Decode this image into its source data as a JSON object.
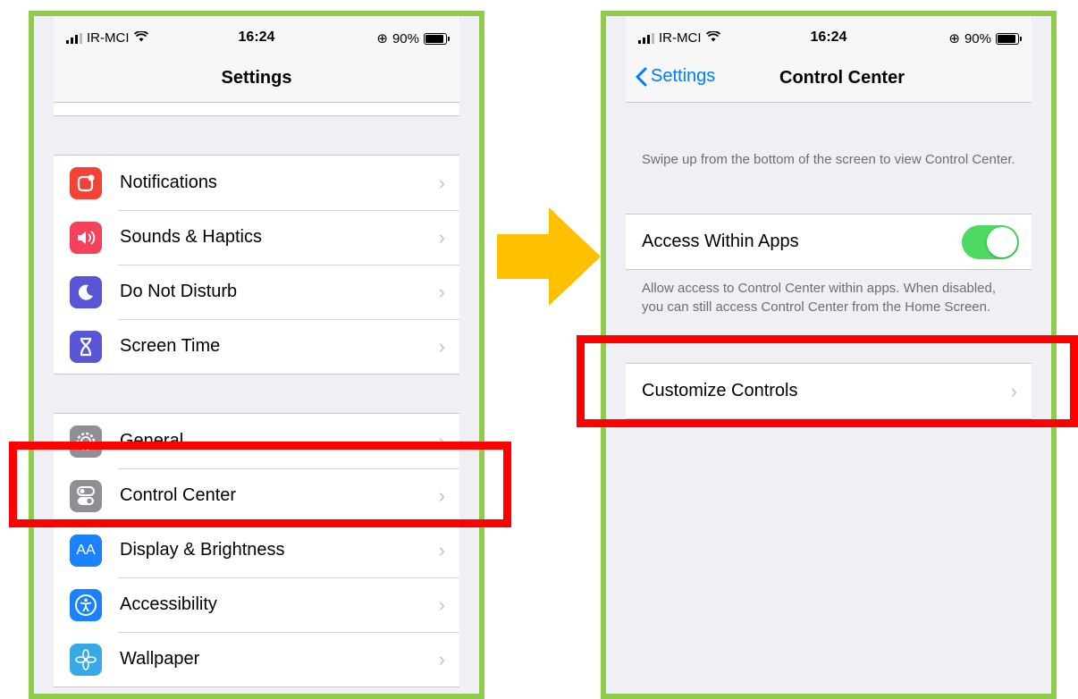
{
  "statusbar": {
    "carrier": "IR-MCI",
    "time": "16:24",
    "battery": "90%"
  },
  "left_screen": {
    "title": "Settings",
    "group1": [
      {
        "label": "Notifications",
        "icon": "notifications-icon",
        "color": "#f44336"
      },
      {
        "label": "Sounds & Haptics",
        "icon": "sounds-icon",
        "color": "#f5425b"
      },
      {
        "label": "Do Not Disturb",
        "icon": "moon-icon",
        "color": "#5856d6"
      },
      {
        "label": "Screen Time",
        "icon": "hourglass-icon",
        "color": "#5856d6"
      }
    ],
    "group2": [
      {
        "label": "General",
        "icon": "gear-icon",
        "color": "#8e8e93"
      },
      {
        "label": "Control Center",
        "icon": "toggles-icon",
        "color": "#8e8e93"
      },
      {
        "label": "Display & Brightness",
        "icon": "display-icon",
        "color": "#1a82fb",
        "glyph": "AA"
      },
      {
        "label": "Accessibility",
        "icon": "accessibility-icon",
        "color": "#1a82fb"
      },
      {
        "label": "Wallpaper",
        "icon": "flower-icon",
        "color": "#38a8e6"
      }
    ]
  },
  "right_screen": {
    "back_label": "Settings",
    "title": "Control Center",
    "intro_text": "Swipe up from the bottom of the screen to view Control Center.",
    "access_within_apps": {
      "label": "Access Within Apps",
      "enabled": true
    },
    "access_footer": "Allow access to Control Center within apps. When disabled, you can still access Control Center from the Home Screen.",
    "customize_label": "Customize Controls"
  },
  "colors": {
    "highlight": "#ff0000",
    "frame": "#8fcc4e",
    "arrow": "#ffc000",
    "ios_blue": "#007aff",
    "toggle_on": "#4cd964"
  }
}
